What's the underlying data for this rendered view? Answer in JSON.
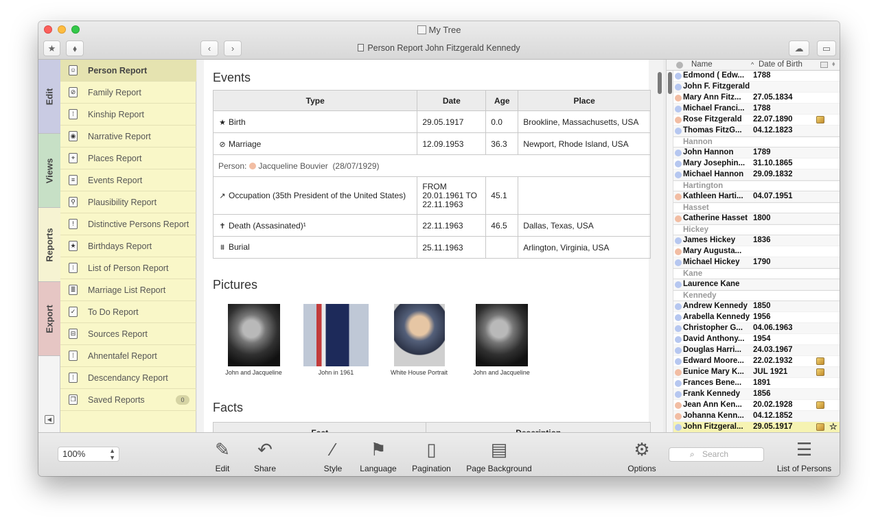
{
  "window": {
    "title": "My Tree",
    "subtitle": "Person Report John Fitzgerald Kennedy"
  },
  "toolbar": {
    "star_icon": "★",
    "tag_icon": "⬧",
    "back_icon": "‹",
    "forward_icon": "›",
    "cloud_icon": "☁",
    "layout_icon": "▭"
  },
  "side_tabs": [
    {
      "label": "Edit"
    },
    {
      "label": "Views"
    },
    {
      "label": "Reports"
    },
    {
      "label": "Export"
    }
  ],
  "reports": [
    {
      "label": "Person Report",
      "icon": "☺"
    },
    {
      "label": "Family Report",
      "icon": "⊘"
    },
    {
      "label": "Kinship Report",
      "icon": "⁞"
    },
    {
      "label": "Narrative Report",
      "icon": "◉"
    },
    {
      "label": "Places Report",
      "icon": "⌖"
    },
    {
      "label": "Events Report",
      "icon": "≡"
    },
    {
      "label": "Plausibility Report",
      "icon": "⚲"
    },
    {
      "label": "Distinctive Persons Report",
      "icon": "!"
    },
    {
      "label": "Birthdays Report",
      "icon": "★"
    },
    {
      "label": "List of Person Report",
      "icon": "⁝"
    },
    {
      "label": "Marriage List Report",
      "icon": "≣"
    },
    {
      "label": "To Do Report",
      "icon": "✓"
    },
    {
      "label": "Sources Report",
      "icon": "⊟"
    },
    {
      "label": "Ahnentafel Report",
      "icon": "⁞"
    },
    {
      "label": "Descendancy Report",
      "icon": "⁞"
    },
    {
      "label": "Saved Reports",
      "icon": "❐",
      "badge": "0"
    }
  ],
  "events": {
    "title": "Events",
    "headers": [
      "Type",
      "Date",
      "Age",
      "Place"
    ],
    "rows": [
      {
        "icon": "★",
        "type": "Birth",
        "date": "29.05.1917",
        "age": "0.0",
        "place": "Brookline, Massachusetts, USA"
      },
      {
        "icon": "⊘",
        "type": "Marriage",
        "date": "12.09.1953",
        "age": "36.3",
        "place": "Newport, Rhode Island, USA"
      },
      {
        "icon": "↗",
        "type": "Occupation (35th President of the United States)",
        "date": "FROM 20.01.1961 TO 22.11.1963",
        "age": "45.1",
        "place": ""
      },
      {
        "icon": "✝",
        "type": "Death (Assasinated)¹",
        "date": "22.11.1963",
        "age": "46.5",
        "place": "Dallas, Texas, USA"
      },
      {
        "icon": "⩩",
        "type": "Burial",
        "date": "25.11.1963",
        "age": "",
        "place": "Arlington, Virginia, USA"
      }
    ],
    "spouse": {
      "label": "Person:",
      "name": "Jacqueline Bouvier",
      "dates": "(28/07/1929)"
    }
  },
  "pictures": {
    "title": "Pictures",
    "items": [
      {
        "caption": "John and Jacqueline"
      },
      {
        "caption": "John in 1961"
      },
      {
        "caption": "White House Portrait"
      },
      {
        "caption": "John and Jacqueline"
      }
    ]
  },
  "facts": {
    "title": "Facts",
    "headers": [
      "Fact",
      "Description"
    ]
  },
  "persons": {
    "headers": {
      "name": "Name",
      "date": "Date of Birth"
    },
    "rows": [
      {
        "name": "Edmond ( Edw...",
        "date": "1788",
        "sex": "m"
      },
      {
        "name": "John F. Fitzgerald",
        "date": "",
        "sex": "m"
      },
      {
        "name": "Mary Ann Fitz...",
        "date": "27.05.1834",
        "sex": "f"
      },
      {
        "name": "Michael Franci...",
        "date": "1788",
        "sex": "m"
      },
      {
        "name": "Rose Fitzgerald",
        "date": "22.07.1890",
        "sex": "f",
        "pic": true
      },
      {
        "name": "Thomas FitzG...",
        "date": "04.12.1823",
        "sex": "m"
      },
      {
        "group": "Hannon"
      },
      {
        "name": "John Hannon",
        "date": "1789",
        "sex": "m"
      },
      {
        "name": "Mary Josephin...",
        "date": "31.10.1865",
        "sex": "m"
      },
      {
        "name": "Michael Hannon",
        "date": "29.09.1832",
        "sex": "m"
      },
      {
        "group": "Hartington"
      },
      {
        "name": "Kathleen Harti...",
        "date": "04.07.1951",
        "sex": "f"
      },
      {
        "group": "Hasset"
      },
      {
        "name": "Catherine Hasset",
        "date": "1800",
        "sex": "f"
      },
      {
        "group": "Hickey"
      },
      {
        "name": "James Hickey",
        "date": "1836",
        "sex": "m"
      },
      {
        "name": "Mary Augusta...",
        "date": "",
        "sex": "f"
      },
      {
        "name": "Michael Hickey",
        "date": "1790",
        "sex": "m"
      },
      {
        "group": "Kane"
      },
      {
        "name": "Laurence Kane",
        "date": "",
        "sex": "m"
      },
      {
        "group": "Kennedy"
      },
      {
        "name": "Andrew Kennedy",
        "date": "1850",
        "sex": "m"
      },
      {
        "name": "Arabella Kennedy",
        "date": "1956",
        "sex": "m"
      },
      {
        "name": "Christopher G...",
        "date": "04.06.1963",
        "sex": "m"
      },
      {
        "name": "David Anthony...",
        "date": "1954",
        "sex": "m"
      },
      {
        "name": "Douglas Harri...",
        "date": "24.03.1967",
        "sex": "m"
      },
      {
        "name": "Edward Moore...",
        "date": "22.02.1932",
        "sex": "m",
        "pic": true
      },
      {
        "name": "Eunice Mary K...",
        "date": "JUL 1921",
        "sex": "f",
        "pic": true
      },
      {
        "name": "Frances Bene...",
        "date": "1891",
        "sex": "m"
      },
      {
        "name": "Frank Kennedy",
        "date": "1856",
        "sex": "m"
      },
      {
        "name": "Jean Ann Ken...",
        "date": "20.02.1928",
        "sex": "f",
        "pic": true
      },
      {
        "name": "Johanna Kenn...",
        "date": "04.12.1852",
        "sex": "f"
      },
      {
        "name": "John Fitzgeral...",
        "date": "29.05.1917",
        "sex": "m",
        "pic": true,
        "star": true,
        "selected": true
      }
    ]
  },
  "bottom": {
    "zoom": "100%",
    "items": [
      {
        "label": "Edit",
        "icon": "✎"
      },
      {
        "label": "Share",
        "icon": "↶"
      },
      {
        "label": "Style",
        "icon": "⁄"
      },
      {
        "label": "Language",
        "icon": "⚑"
      },
      {
        "label": "Pagination",
        "icon": "▯"
      },
      {
        "label": "Page Background",
        "icon": "▤"
      },
      {
        "label": "Options",
        "icon": "⚙"
      },
      {
        "label": "List of Persons",
        "icon": "☰"
      }
    ],
    "search_placeholder": "Search"
  },
  "colors": {
    "male_dot": "#b6c7f0",
    "female_dot": "#f2bda3"
  }
}
